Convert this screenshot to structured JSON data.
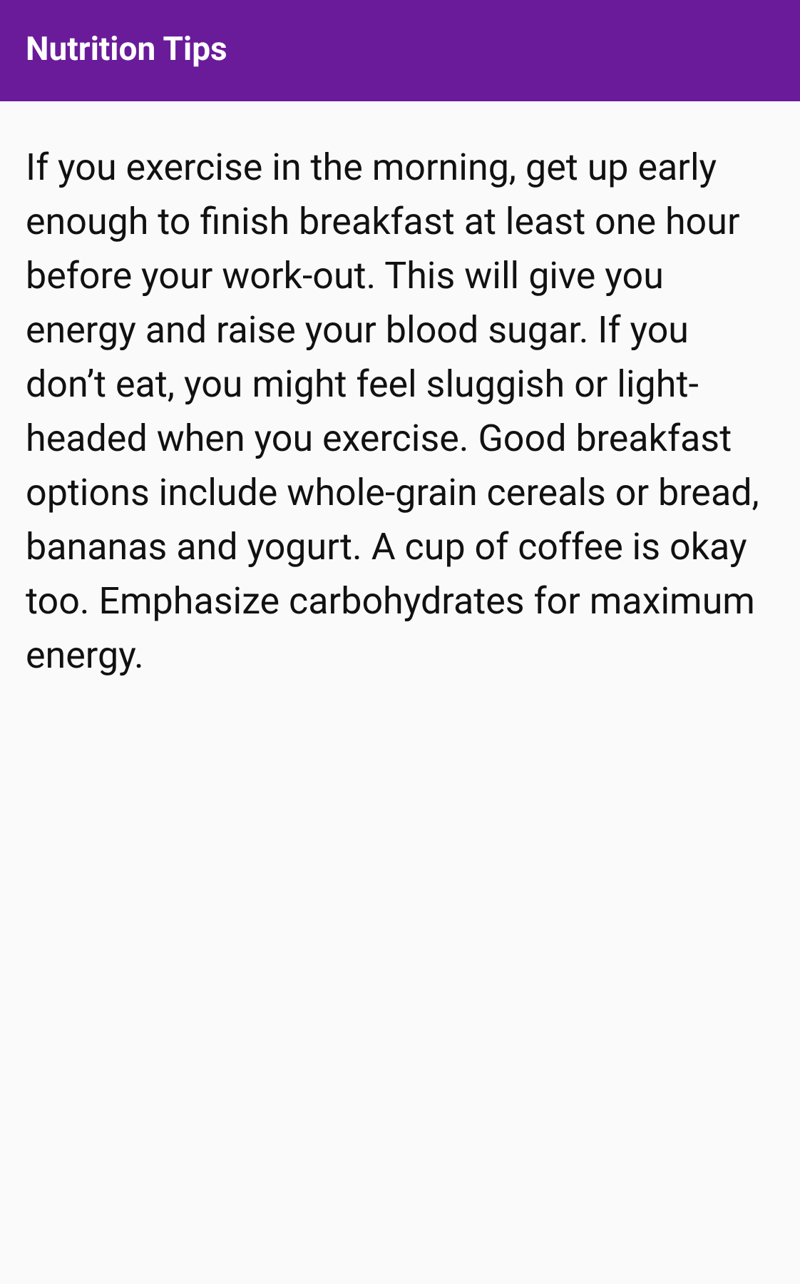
{
  "app_bar": {
    "title": "Nutrition Tips"
  },
  "tip": {
    "text": "If you exercise in the morning, get up early enough to finish breakfast at least one hour before your work-out. This will give you energy and raise your blood sugar. If you don’t eat, you might feel sluggish or light-headed when you exercise. Good breakfast options include whole-grain cereals or bread, bananas and yogurt. A cup of coffee is okay too. Emphasize carbohydrates for maximum energy."
  }
}
